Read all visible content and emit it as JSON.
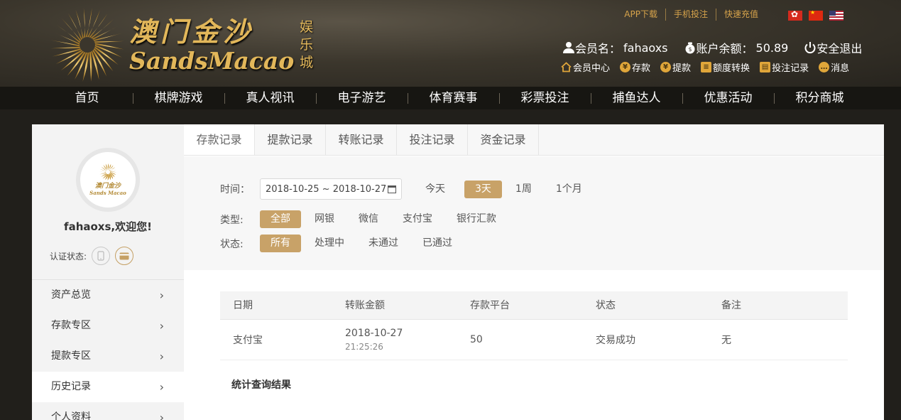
{
  "brand": {
    "name_cn": "澳门金沙",
    "name_en": "SandsMacao",
    "sub_cn": "娱乐城"
  },
  "top_links": [
    "APP下载",
    "手机投注",
    "快速充值"
  ],
  "flags": [
    "hk-flag-icon",
    "cn-flag-icon",
    "us-flag-icon"
  ],
  "user": {
    "member_label": "会员名：",
    "member_name": "fahaoxs",
    "balance_label": "账户余额：",
    "balance_value": "50.89",
    "logout_label": "安全退出"
  },
  "quick_links": [
    {
      "label": "会员中心",
      "icon": "home-icon"
    },
    {
      "label": "存款",
      "icon": "yen-icon"
    },
    {
      "label": "提款",
      "icon": "yen-icon"
    },
    {
      "label": "额度转换",
      "icon": "coins-icon"
    },
    {
      "label": "投注记录",
      "icon": "document-icon"
    },
    {
      "label": "消息",
      "icon": "chat-icon"
    }
  ],
  "nav": [
    "首页",
    "棋牌游戏",
    "真人视讯",
    "电子游艺",
    "体育赛事",
    "彩票投注",
    "捕鱼达人",
    "优惠活动",
    "积分商城"
  ],
  "sidebar": {
    "avatar_text": "澳门金沙",
    "avatar_text_en": "Sands Macao",
    "welcome": "fahaoxs,欢迎您!",
    "verify_label": "认证状态:",
    "menu": [
      "资产总览",
      "存款专区",
      "提款专区",
      "历史记录",
      "个人资料"
    ],
    "active_menu": "历史记录"
  },
  "tabs": [
    "存款记录",
    "提款记录",
    "转账记录",
    "投注记录",
    "资金记录"
  ],
  "active_tab": "存款记录",
  "filters": {
    "time_label": "时间：",
    "date_range": "2018-10-25 ~ 2018-10-27",
    "time_options": [
      "今天",
      "3天",
      "1周",
      "1个月"
    ],
    "time_selected": "3天",
    "type_label": "类型:",
    "type_options": [
      "全部",
      "网银",
      "微信",
      "支付宝",
      "银行汇款"
    ],
    "type_selected": "全部",
    "status_label": "状态:",
    "status_options": [
      "所有",
      "处理中",
      "未通过",
      "已通过"
    ],
    "status_selected": "所有"
  },
  "table": {
    "headers": [
      "日期",
      "转账金额",
      "存款平台",
      "状态",
      "备注"
    ],
    "rows": [
      {
        "c1": "支付宝",
        "c2_date": "2018-10-27",
        "c2_time": "21:25:26",
        "c3": "50",
        "c4": "交易成功",
        "c5": "无"
      }
    ]
  },
  "stats_label": "统计查询结果",
  "colors": {
    "accent": "#c8a268",
    "gold": "#e2b75a",
    "header_bg": "#3b362c",
    "nav_bg": "#171612"
  }
}
